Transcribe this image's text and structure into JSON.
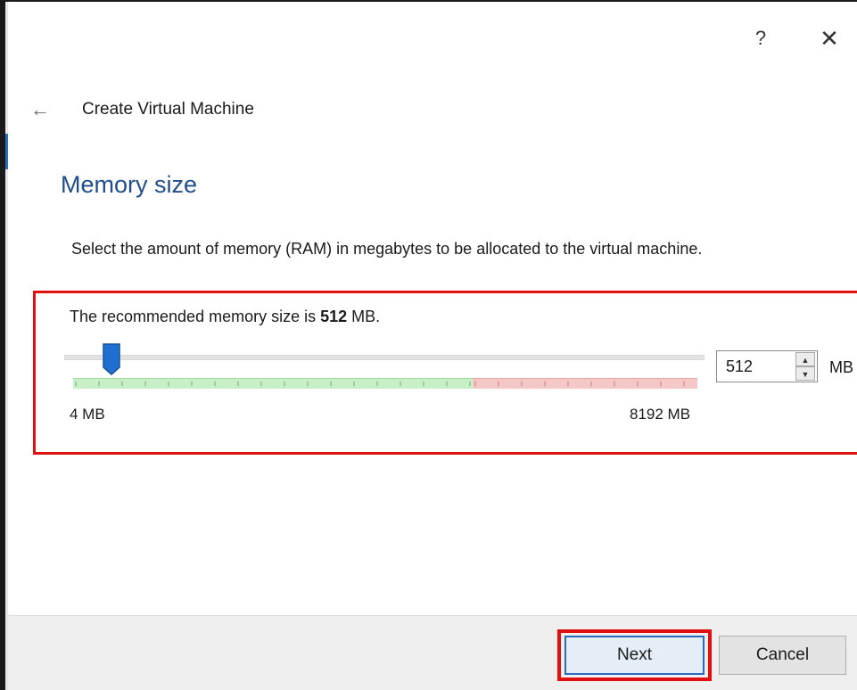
{
  "title_bar": {
    "help_icon": "help-icon",
    "help_glyph": "?",
    "close_icon": "close-icon",
    "close_glyph": "✕"
  },
  "header": {
    "back_icon": "back-arrow-icon",
    "back_glyph": "←",
    "title": "Create Virtual Machine"
  },
  "page": {
    "heading": "Memory size",
    "description": "Select the amount of memory (RAM) in megabytes to be allocated to the virtual machine.",
    "recommended_prefix": "The recommended memory size is",
    "recommended_value": "512",
    "recommended_suffix": "MB."
  },
  "memory_slider": {
    "min_label": "4 MB",
    "max_label": "8192 MB",
    "min_mb": 4,
    "max_mb": 8192,
    "value_mb": 512,
    "recommended_range_fraction": 0.64
  },
  "spinbox": {
    "value": "512",
    "unit": "MB",
    "up_glyph": "▲",
    "down_glyph": "▼"
  },
  "buttons": {
    "next_label": "Next",
    "cancel_label": "Cancel"
  },
  "colors": {
    "heading_blue": "#1f4e8c",
    "highlight_red": "#e01010",
    "safe_green": "#c9efc9",
    "warn_red": "#f5c8c8",
    "slider_handle": "#1f6fd0"
  }
}
